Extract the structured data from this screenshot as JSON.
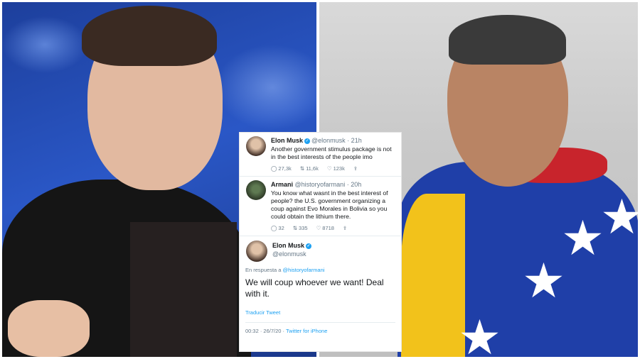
{
  "tweets": [
    {
      "name": "Elon Musk",
      "handle": "@elonmusk",
      "time": "· 21h",
      "text": "Another government stimulus package is not in the best interests of the people imo",
      "replies": "27,3k",
      "retweets": "11,6k",
      "likes": "123k"
    },
    {
      "name": "Armani",
      "handle": "@historyofarmani",
      "time": "· 20h",
      "text": "You know what wasnt in the best interest of people? the U.S. government organizing a coup against Evo Morales in Bolivia so you could obtain the lithium there.",
      "replies": "32",
      "retweets": "335",
      "likes": "8718"
    }
  ],
  "main_tweet": {
    "name": "Elon Musk",
    "handle": "@elonmusk",
    "reply_prefix": "En respuesta a",
    "reply_to": "@historyofarmani",
    "text": "We will coup whoever we want! Deal with it.",
    "translate": "Traducir Tweet",
    "timestamp": "00:32 · 26/7/20 ·",
    "client": "Twitter for iPhone"
  },
  "icons": {
    "reply": "reply-icon",
    "retweet": "retweet-icon",
    "like": "like-icon",
    "share": "share-icon",
    "verified": "verified-badge-icon"
  },
  "colors": {
    "twitter_blue": "#1da1f2",
    "left_bg": "#2a57c6",
    "right_bg": "#cfcfcf"
  }
}
